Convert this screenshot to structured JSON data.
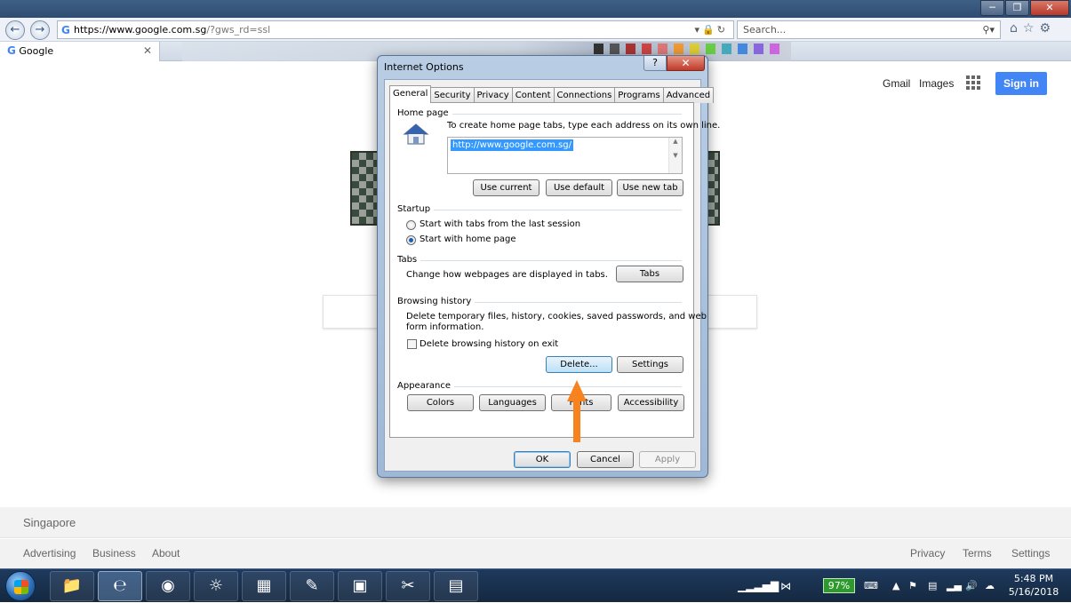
{
  "browser": {
    "address": {
      "favicon": "G",
      "host": "https://www.google.com.sg",
      "rest": "/?gws_rd=ssl"
    },
    "search_placeholder": "Search...",
    "tab": {
      "favicon": "G",
      "title": "Google"
    },
    "window_controls": [
      "minimize",
      "restore",
      "close"
    ]
  },
  "google": {
    "links": {
      "gmail": "Gmail",
      "images": "Images"
    },
    "signin": "Sign in",
    "footer_country": "Singapore",
    "footer_left": [
      "Advertising",
      "Business",
      "About"
    ],
    "footer_right": [
      "Privacy",
      "Terms",
      "Settings"
    ],
    "colors": {
      "signin": "#4285f4",
      "footer_bg": "#f2f2f2"
    }
  },
  "dialog": {
    "title": "Internet Options",
    "help_label": "?",
    "close_label": "✕",
    "tabs": [
      "General",
      "Security",
      "Privacy",
      "Content",
      "Connections",
      "Programs",
      "Advanced"
    ],
    "active_tab": "General",
    "home_page": {
      "group": "Home page",
      "instructions": "To create home page tabs, type each address on its own line.",
      "url": "http://www.google.com.sg/",
      "buttons": [
        "Use current",
        "Use default",
        "Use new tab"
      ]
    },
    "startup": {
      "group": "Startup",
      "options": [
        "Start with tabs from the last session",
        "Start with home page"
      ],
      "selected": "Start with home page"
    },
    "tabs_group": {
      "group": "Tabs",
      "description": "Change how webpages are displayed in tabs.",
      "button": "Tabs"
    },
    "browsing_history": {
      "group": "Browsing history",
      "description_line1": "Delete temporary files, history, cookies, saved passwords, and web",
      "description_line2": "form information.",
      "checkbox": "Delete browsing history on exit",
      "checked": false,
      "delete_button": "Delete...",
      "settings_button": "Settings"
    },
    "appearance": {
      "group": "Appearance",
      "buttons": [
        "Colors",
        "Languages",
        "Fonts",
        "Accessibility"
      ]
    },
    "footer_buttons": {
      "ok": "OK",
      "cancel": "Cancel",
      "apply": "Apply"
    },
    "colors": {
      "annotation_arrow": "#f7821e",
      "selection": "#3399ff"
    }
  },
  "taskbar": {
    "apps": [
      "windows-explorer",
      "internet-explorer",
      "chrome",
      "firefox",
      "calculator",
      "paint",
      "sticky-chart",
      "snipping-tool",
      "remote-desktop"
    ],
    "battery": "97%",
    "time": "5:48 PM",
    "date": "5/16/2018"
  }
}
